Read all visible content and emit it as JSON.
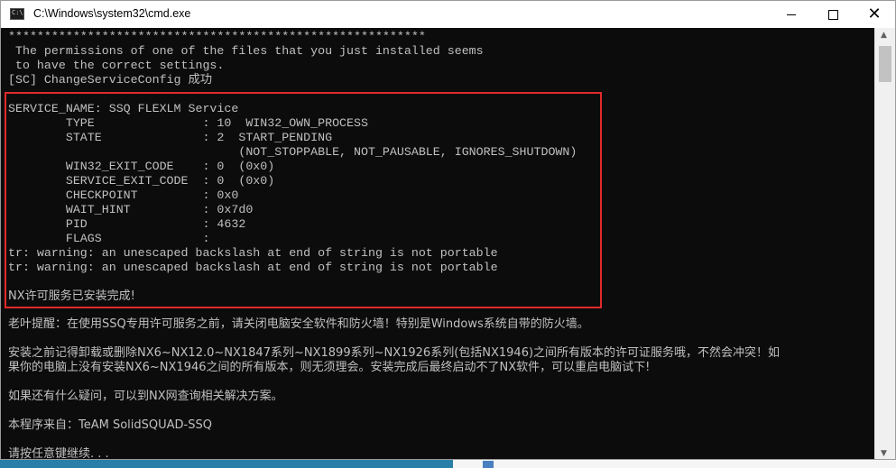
{
  "window": {
    "title": "C:\\Windows\\system32\\cmd.exe",
    "icon_label": "C:\\",
    "controls": {
      "minimize": "",
      "maximize": "",
      "close": "✕"
    }
  },
  "console": {
    "stars": "**********************************************************",
    "perm_line1": " The permissions of one of the files that you just installed seems",
    "perm_line2": " to have the correct settings.",
    "sc_line": "[SC] ChangeServiceConfig 成功",
    "service": {
      "name": "SERVICE_NAME: SSQ FLEXLM Service",
      "type": "        TYPE               : 10  WIN32_OWN_PROCESS",
      "state": "        STATE              : 2  START_PENDING",
      "state_flags": "                                (NOT_STOPPABLE, NOT_PAUSABLE, IGNORES_SHUTDOWN)",
      "win32_exit": "        WIN32_EXIT_CODE    : 0  (0x0)",
      "service_exit": "        SERVICE_EXIT_CODE  : 0  (0x0)",
      "checkpoint": "        CHECKPOINT         : 0x0",
      "wait_hint": "        WAIT_HINT          : 0x7d0",
      "pid": "        PID                : 4632",
      "flags": "        FLAGS              :"
    },
    "tr_warning_1": "tr: warning: an unescaped backslash at end of string is not portable",
    "tr_warning_2": "tr: warning: an unescaped backslash at end of string is not portable",
    "install_done": "NX许可服务已安装完成!",
    "reminder": "老叶提醒：在使用SSQ专用许可服务之前，请关闭电脑安全软件和防火墙！特别是Windows系统自带的防火墙。",
    "uninstall_line1": "安装之前记得卸载或删除NX6~NX12.0~NX1847系列~NX1899系列~NX1926系列(包括NX1946)之间所有版本的许可证服务哦，不然会冲突！如",
    "uninstall_line2": "果你的电脑上没有安装NX6~NX1946之间的所有版本，则无须理会。安装完成后最终启动不了NX软件，可以重启电脑试下!",
    "questions": "如果还有什么疑问，可以到NX网查询相关解决方案。",
    "source": "本程序来自：TeAM SolidSQUAD-SSQ",
    "press_key": "请按任意键继续. . ."
  },
  "colors": {
    "console_bg": "#0c0c0c",
    "console_text": "#c0c0c0",
    "highlight": "#e12a2a"
  }
}
